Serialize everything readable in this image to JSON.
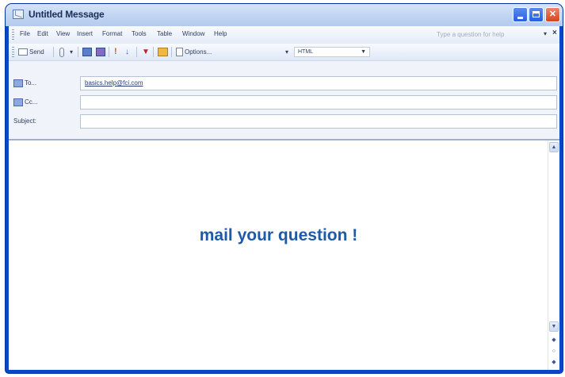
{
  "window": {
    "title": "Untitled Message"
  },
  "menu": {
    "items": [
      "File",
      "Edit",
      "View",
      "Insert",
      "Format",
      "Tools",
      "Table",
      "Window",
      "Help"
    ],
    "help_placeholder": "Type a question for help"
  },
  "toolbar": {
    "send_label": "Send",
    "options_label": "Options...",
    "format_value": "HTML"
  },
  "fields": {
    "to_label": "To...",
    "to_value": "basics.help@fci.com",
    "cc_label": "Cc...",
    "cc_value": "",
    "subject_label": "Subject:",
    "subject_value": ""
  },
  "body": {
    "text": "mail your question !"
  },
  "colors": {
    "window_frame": "#0a46c8",
    "body_text": "#1f5aa8"
  },
  "icons": [
    "app-icon",
    "minimize-icon",
    "maximize-icon",
    "close-icon",
    "send-icon",
    "attach-icon",
    "address-book-icon",
    "check-names-icon",
    "importance-high-icon",
    "importance-low-icon",
    "flag-icon",
    "permission-icon",
    "options-icon"
  ]
}
